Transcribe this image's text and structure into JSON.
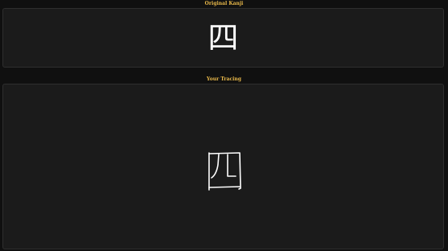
{
  "original": {
    "heading": "Original Kanji",
    "kanji": "四"
  },
  "tracing": {
    "heading": "Your Tracing",
    "stroke_color": "#ffffff"
  },
  "colors": {
    "background": "#101010",
    "panel": "#1b1b1b",
    "heading": "#e8b84a",
    "kanji": "#ffffff"
  }
}
